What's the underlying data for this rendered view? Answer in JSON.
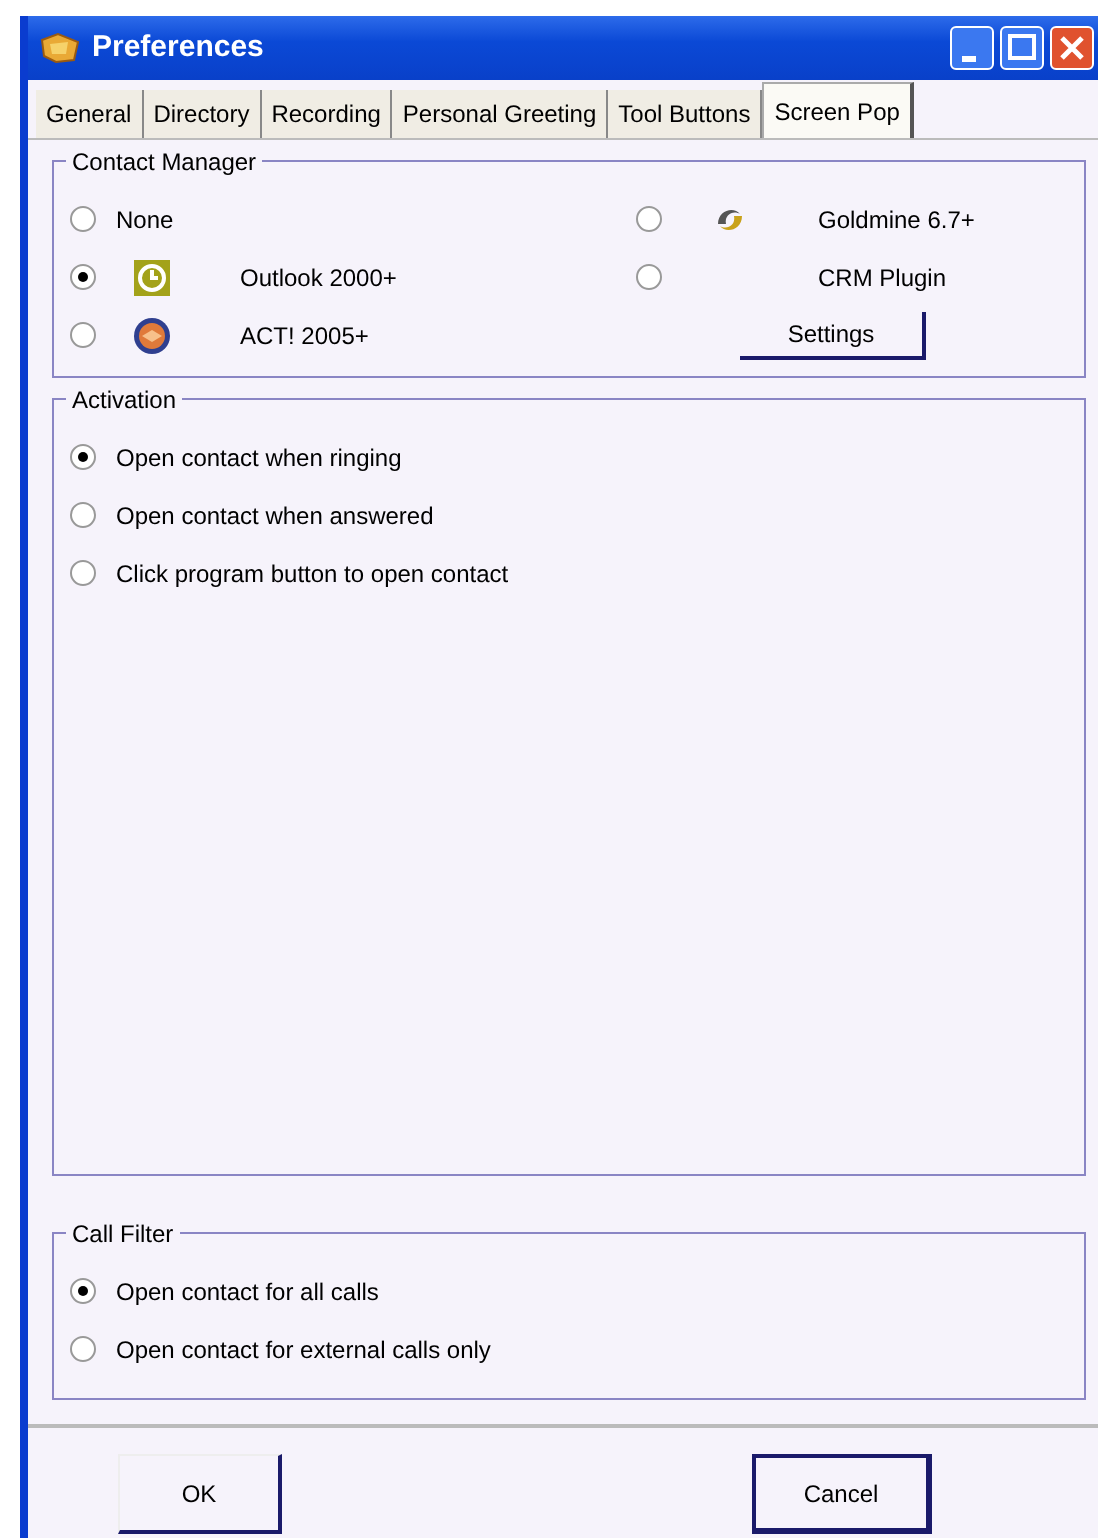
{
  "window": {
    "title": "Preferences"
  },
  "tabs": [
    {
      "label": "General",
      "selected": false
    },
    {
      "label": "Directory",
      "selected": false
    },
    {
      "label": "Recording",
      "selected": false
    },
    {
      "label": "Personal Greeting",
      "selected": false
    },
    {
      "label": "Tool Buttons",
      "selected": false
    },
    {
      "label": "Screen Pop",
      "selected": true
    }
  ],
  "contact_manager": {
    "title": "Contact Manager",
    "options": [
      {
        "label": "None",
        "kind": "plain",
        "selected": false
      },
      {
        "label": "Outlook 2000+",
        "kind": "app",
        "selected": true
      },
      {
        "label": "ACT! 2005+",
        "kind": "app",
        "selected": false
      },
      {
        "label": "Goldmine 6.7+",
        "kind": "app",
        "selected": false
      },
      {
        "label": "CRM Plugin",
        "kind": "spaced",
        "selected": false
      }
    ],
    "settings_button": "Settings"
  },
  "activation": {
    "title": "Activation",
    "options": [
      {
        "label": "Open contact when ringing",
        "selected": true
      },
      {
        "label": "Open contact when answered",
        "selected": false
      },
      {
        "label": "Click program button to open contact",
        "selected": false
      }
    ]
  },
  "call_filter": {
    "title": "Call Filter",
    "options": [
      {
        "label": "Open contact for all calls",
        "selected": true
      },
      {
        "label": "Open contact for external calls only",
        "selected": false
      }
    ]
  },
  "buttons": [
    "OK",
    "Cancel"
  ]
}
